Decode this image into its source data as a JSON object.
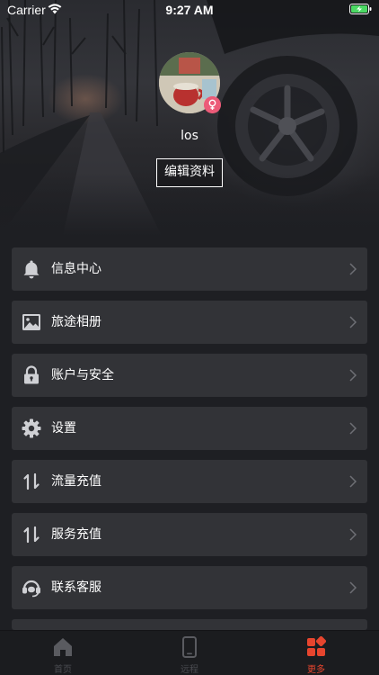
{
  "status_bar": {
    "carrier": "Carrier",
    "time": "9:27 AM"
  },
  "profile": {
    "username": "los",
    "edit_button_label": "编辑资料"
  },
  "menu": [
    {
      "label": "信息中心",
      "icon": "bell-icon"
    },
    {
      "label": "旅途相册",
      "icon": "image-icon"
    },
    {
      "label": "账户与安全",
      "icon": "lock-icon"
    },
    {
      "label": "设置",
      "icon": "gear-icon"
    },
    {
      "label": "流量充值",
      "icon": "transfer-arrows-icon"
    },
    {
      "label": "服务充值",
      "icon": "transfer-arrows-icon"
    },
    {
      "label": "联系客服",
      "icon": "headset-icon"
    }
  ],
  "tab_bar": [
    {
      "label": "首页",
      "icon": "home-icon",
      "active": false
    },
    {
      "label": "远程",
      "icon": "phone-icon",
      "active": false
    },
    {
      "label": "更多",
      "icon": "grid-icon",
      "active": true
    }
  ],
  "colors": {
    "accent": "#e6452e",
    "background": "#1e1f23",
    "row": "#323337",
    "badge": "#ec5b78"
  }
}
